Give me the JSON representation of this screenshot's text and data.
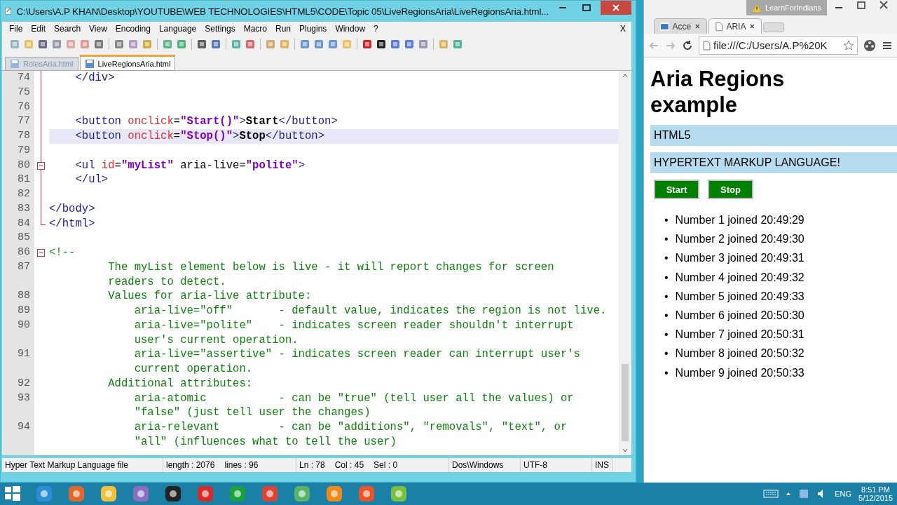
{
  "editor_window": {
    "title": "C:\\Users\\A.P KHAN\\Desktop\\YOUTUBE\\WEB TECHNOLOGIES\\HTML5\\CODE\\Topic 05\\LiveRegionsAria\\LiveRegionsAria.html...",
    "menu": [
      "File",
      "Edit",
      "Search",
      "View",
      "Encoding",
      "Language",
      "Settings",
      "Macro",
      "Run",
      "Plugins",
      "Window",
      "?"
    ],
    "menu_close": "X",
    "tabs": [
      {
        "label": "RolesAria.html",
        "selected": false
      },
      {
        "label": "LiveRegionsAria.html",
        "selected": true
      }
    ],
    "code_lines": [
      {
        "number": "74",
        "in_fold": true,
        "fold_start": false,
        "current": false,
        "tokens": [
          {
            "kind": "tag",
            "text": "    </div>"
          }
        ]
      },
      {
        "number": "75",
        "in_fold": true,
        "fold_start": false,
        "current": false
      },
      {
        "number": "76",
        "in_fold": true,
        "fold_start": false,
        "current": false
      },
      {
        "number": "77",
        "in_fold": true,
        "fold_start": false,
        "current": false,
        "tokens": [
          {
            "kind": "tag",
            "text": "    <button"
          },
          {
            "kind": "attr",
            "text": " onclick"
          },
          {
            "kind": "plain",
            "text": "="
          },
          {
            "kind": "value",
            "text": "\"Start()\""
          },
          {
            "kind": "tag",
            "text": ">"
          },
          {
            "kind": "content",
            "text": "Start"
          },
          {
            "kind": "tag",
            "text": "</button>"
          }
        ]
      },
      {
        "number": "78",
        "in_fold": true,
        "fold_start": false,
        "current": true,
        "tokens": [
          {
            "kind": "tag",
            "text": "    <button"
          },
          {
            "kind": "attr",
            "text": " onclick"
          },
          {
            "kind": "plain",
            "text": "="
          },
          {
            "kind": "value",
            "text": "\"Stop()\""
          },
          {
            "kind": "tag",
            "text": ">"
          },
          {
            "kind": "content",
            "text": "Stop"
          },
          {
            "kind": "tag",
            "text": "</button>"
          }
        ]
      },
      {
        "number": "79",
        "in_fold": true,
        "fold_start": false,
        "current": false
      },
      {
        "number": "80",
        "in_fold": true,
        "fold_start": true,
        "current": false,
        "tokens": [
          {
            "kind": "tag",
            "text": "    <ul"
          },
          {
            "kind": "attr",
            "text": " id"
          },
          {
            "kind": "plain",
            "text": "="
          },
          {
            "kind": "value",
            "text": "\"myList\""
          },
          {
            "kind": "plain",
            "text": " aria-live="
          },
          {
            "kind": "value",
            "text": "\"polite\""
          },
          {
            "kind": "tag",
            "text": ">"
          }
        ]
      },
      {
        "number": "81",
        "in_fold": true,
        "fold_start": false,
        "current": false,
        "tokens": [
          {
            "kind": "tag",
            "text": "    </ul>"
          }
        ]
      },
      {
        "number": "82",
        "in_fold": true,
        "fold_start": false,
        "current": false
      },
      {
        "number": "83",
        "in_fold": true,
        "fold_start": false,
        "current": false,
        "tokens": [
          {
            "kind": "tag",
            "text": "</body>"
          }
        ]
      },
      {
        "number": "84",
        "in_fold": true,
        "fold_start": false,
        "current": false,
        "tokens": [
          {
            "kind": "tag",
            "text": "</html>"
          }
        ]
      },
      {
        "number": "85",
        "in_fold": false,
        "fold_start": false,
        "current": false
      },
      {
        "number": "86",
        "in_fold": false,
        "fold_start": true,
        "current": false,
        "tokens": [
          {
            "kind": "comment",
            "text": "<!--"
          }
        ]
      },
      {
        "number": "87",
        "in_fold": false,
        "fold_start": false,
        "current": false,
        "tokens": [
          {
            "kind": "comment",
            "text": "         The myList element below is live - it will report changes for screen"
          }
        ]
      },
      {
        "in_fold": false,
        "fold_start": false,
        "current": false,
        "tokens": [
          {
            "kind": "comment",
            "text": "         readers to detect."
          }
        ]
      },
      {
        "number": "88",
        "in_fold": false,
        "fold_start": false,
        "current": false,
        "tokens": [
          {
            "kind": "comment",
            "text": "         Values for aria-live attribute:"
          }
        ]
      },
      {
        "number": "89",
        "in_fold": false,
        "fold_start": false,
        "current": false,
        "tokens": [
          {
            "kind": "comment",
            "text": "             aria-live=\"off\"       - default value, indicates the region is not live."
          }
        ]
      },
      {
        "number": "90",
        "in_fold": false,
        "fold_start": false,
        "current": false,
        "tokens": [
          {
            "kind": "comment",
            "text": "             aria-live=\"polite\"    - indicates screen reader shouldn't interrupt"
          }
        ]
      },
      {
        "in_fold": false,
        "fold_start": false,
        "current": false,
        "tokens": [
          {
            "kind": "comment",
            "text": "             user's current operation."
          }
        ]
      },
      {
        "number": "91",
        "in_fold": false,
        "fold_start": false,
        "current": false,
        "tokens": [
          {
            "kind": "comment",
            "text": "             aria-live=\"assertive\" - indicates screen reader can interrupt user's"
          }
        ]
      },
      {
        "in_fold": false,
        "fold_start": false,
        "current": false,
        "tokens": [
          {
            "kind": "comment",
            "text": "             current operation."
          }
        ]
      },
      {
        "number": "92",
        "in_fold": false,
        "fold_start": false,
        "current": false,
        "tokens": [
          {
            "kind": "comment",
            "text": "         Additional attributes:"
          }
        ]
      },
      {
        "number": "93",
        "in_fold": false,
        "fold_start": false,
        "current": false,
        "tokens": [
          {
            "kind": "comment",
            "text": "             aria-atomic           - can be \"true\" (tell user all the values) or"
          }
        ]
      },
      {
        "in_fold": false,
        "fold_start": false,
        "current": false,
        "tokens": [
          {
            "kind": "comment",
            "text": "             \"false\" (just tell user the changes)"
          }
        ]
      },
      {
        "number": "94",
        "in_fold": false,
        "fold_start": false,
        "current": false,
        "tokens": [
          {
            "kind": "comment",
            "text": "             aria-relevant         - can be \"additions\", \"removals\", \"text\", or"
          }
        ]
      },
      {
        "in_fold": false,
        "fold_start": false,
        "current": false,
        "tokens": [
          {
            "kind": "comment",
            "text": "             \"all\" (influences what to tell the user)"
          }
        ]
      }
    ],
    "status_bar": {
      "file_type": "Hyper Text Markup Language file",
      "length": "length : 2076",
      "lines": "lines : 96",
      "line": "Ln : 78",
      "column": "Col : 45",
      "selection": "Sel : 0",
      "eol": "Dos\\Windows",
      "encoding": "UTF-8",
      "mode": "INS"
    }
  },
  "browser_window": {
    "profile": "LearnForIndians",
    "tabs": [
      {
        "label": "Acce",
        "selected": false
      },
      {
        "label": "ARIA",
        "selected": true
      }
    ],
    "address": "file:///C:/Users/A.P%20K",
    "page": {
      "heading": "Aria Regions example",
      "bars": [
        "HTML5",
        "HYPERTEXT MARKUP LANGUAGE!"
      ],
      "buttons": [
        "Start",
        "Stop"
      ],
      "items": [
        {
          "marker": "•",
          "text": "Number 1 joined 20:49:29"
        },
        {
          "marker": "•",
          "text": "Number 2 joined 20:49:30"
        },
        {
          "marker": "•",
          "text": "Number 3 joined 20:49:31"
        },
        {
          "marker": "•",
          "text": "Number 4 joined 20:49:32"
        },
        {
          "marker": "•",
          "text": "Number 5 joined 20:49:33"
        },
        {
          "marker": "•",
          "text": "Number 6 joined 20:50:30"
        },
        {
          "marker": "•",
          "text": "Number 7 joined 20:50:31"
        },
        {
          "marker": "•",
          "text": "Number 8 joined 20:50:32"
        },
        {
          "marker": "•",
          "text": "Number 9 joined 20:50:33"
        }
      ]
    }
  },
  "taskbar": {
    "language": "ENG",
    "time": "8:51 PM",
    "date": "5/12/2015"
  }
}
